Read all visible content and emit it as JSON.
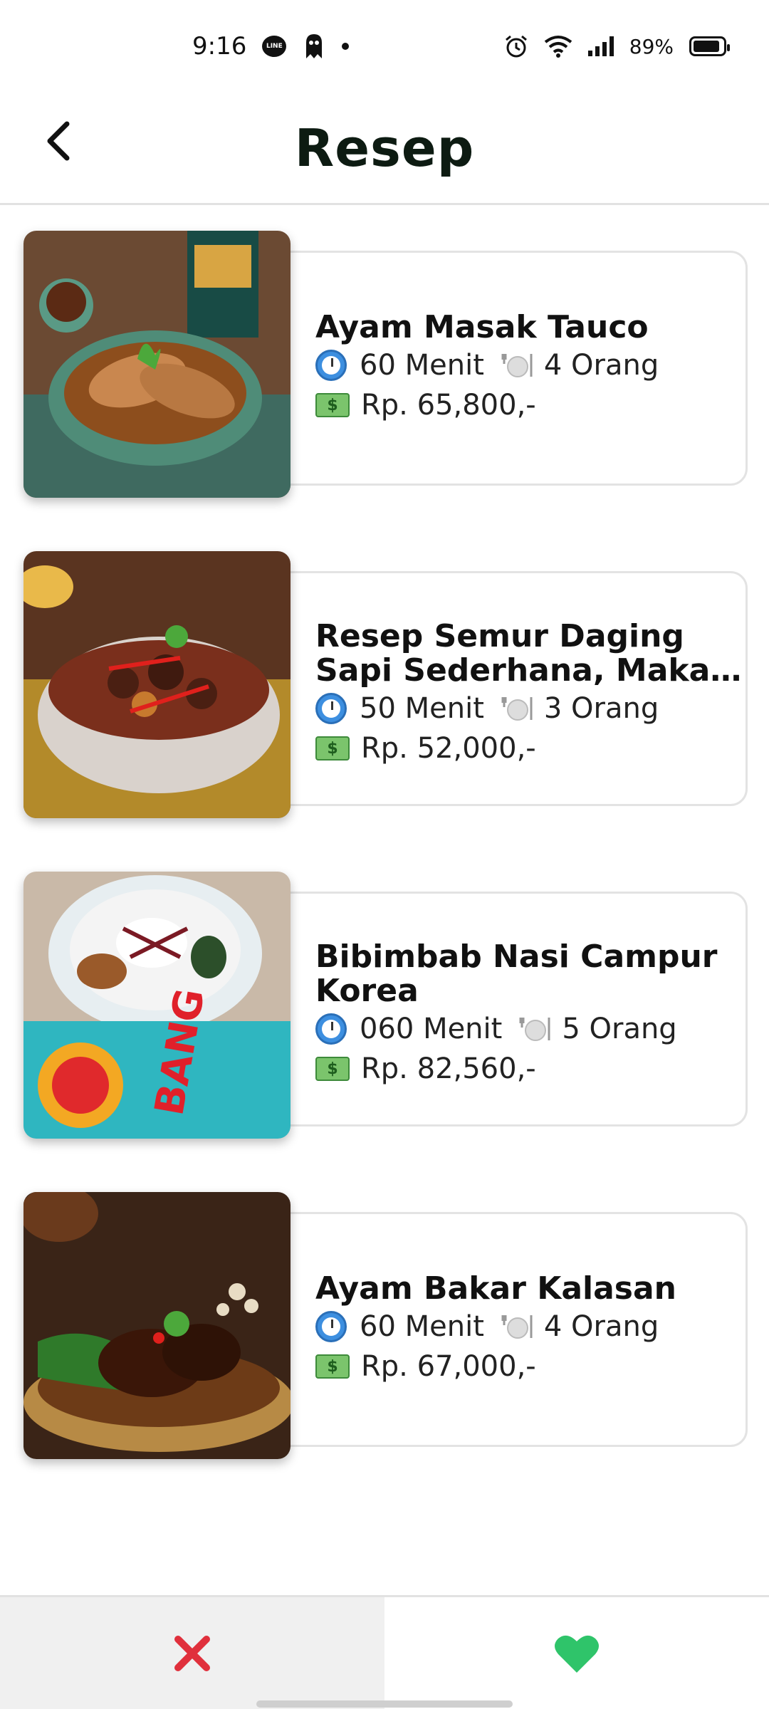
{
  "status_bar": {
    "time": "9:16",
    "battery": "89%",
    "icons": [
      "line-icon",
      "ghost-icon",
      "alarm-icon",
      "wifi-icon",
      "signal-icon",
      "battery-icon"
    ]
  },
  "header": {
    "title": "Resep",
    "back_icon": "back-arrow-icon"
  },
  "recipes": [
    {
      "title": "Ayam Masak Tauco",
      "time": "60 Menit",
      "servings": "4 Orang",
      "price": "Rp. 65,800,-"
    },
    {
      "title_line1": "Resep Semur Daging",
      "title_line2": "Sapi Sederhana, Makan...",
      "time": "50 Menit",
      "servings": "3 Orang",
      "price": "Rp. 52,000,-"
    },
    {
      "title_line1": "Bibimbab Nasi Campur",
      "title_line2": "Korea",
      "time": "060 Menit",
      "servings": "5 Orang",
      "price": "Rp. 82,560,-"
    },
    {
      "title": "Ayam Bakar Kalasan",
      "time": "60 Menit",
      "servings": "4 Orang",
      "price": "Rp. 67,000,-"
    }
  ],
  "bottom_bar": {
    "reject_icon": "close-icon",
    "like_icon": "heart-icon",
    "colors": {
      "reject": "#e0303c",
      "like": "#2fc46a"
    }
  },
  "colors": {
    "title": "#0d1b12",
    "card_border": "#e3e3e3"
  }
}
